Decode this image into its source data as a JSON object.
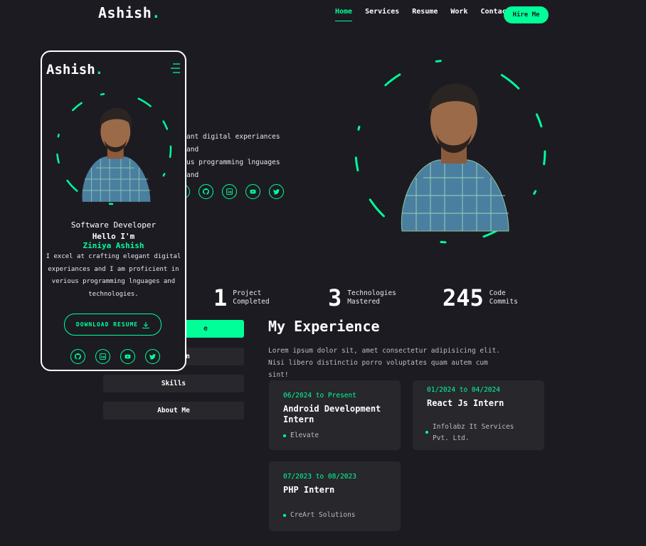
{
  "header": {
    "logo": "Ashish",
    "logo_dot": ".",
    "nav": [
      "Home",
      "Services",
      "Resume",
      "Work",
      "Contact"
    ],
    "active_nav": "Home",
    "hire_label": "Hire Me"
  },
  "hero": {
    "text_visible": "ant digital experiances and\nus programming lnguages and"
  },
  "stats": [
    {
      "num": "1",
      "label_1": "Project",
      "label_2": "Completed"
    },
    {
      "num": "3",
      "label_1": "Technologies",
      "label_2": "Mastered"
    },
    {
      "num": "245",
      "label_1": "Code",
      "label_2": "Commits"
    }
  ],
  "tabs": {
    "partial_1": "e",
    "partial_2": "n",
    "skills": "Skills",
    "about": "About Me"
  },
  "experience": {
    "title": "My Experience",
    "desc": "Lorem ipsum dolor sit, amet consectetur adipisicing elit. Nisi libero distinctio porro voluptates quam autem cum sint!",
    "cards": [
      {
        "date": "06/2024 to Present",
        "role": "Android Development Intern",
        "company": "Elevate"
      },
      {
        "date": "01/2024 to 04/2024",
        "role": "React Js Intern",
        "company": "Infolabz It Services Pvt. Ltd."
      },
      {
        "date": "07/2023 to 08/2023",
        "role": "PHP Intern",
        "company": "CreArt Solutions"
      }
    ]
  },
  "phone": {
    "logo": "Ashish",
    "logo_dot": ".",
    "role": "Software Developer",
    "hello": "Hello I'm",
    "name": "Ziniya Ashish",
    "desc": "I excel at crafting elegant digital experiances and I am proficient in verious programming lnguages and technologies.",
    "download_label": "DOWNLOAD RESUME"
  },
  "colors": {
    "accent": "#00ff99",
    "background": "#1c1b22",
    "card": "#27272c"
  },
  "icons": [
    "github-icon",
    "linkedin-icon",
    "youtube-icon",
    "twitter-icon",
    "download-icon",
    "menu-icon"
  ]
}
